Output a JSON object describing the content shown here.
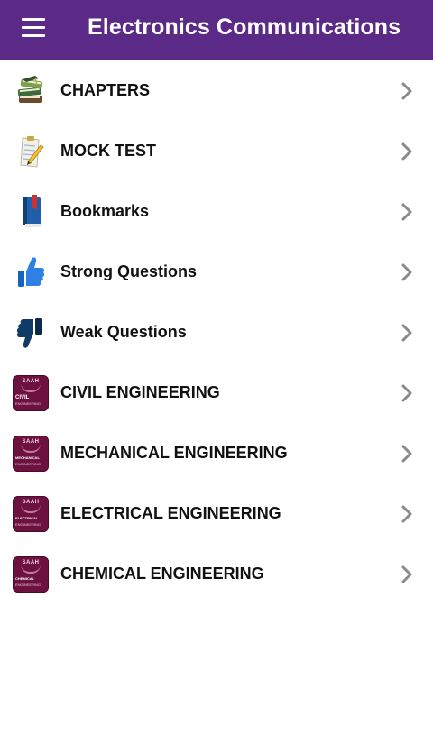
{
  "header": {
    "title": "Electronics Communications",
    "menu_icon": "hamburger-icon"
  },
  "items": [
    {
      "label": "CHAPTERS",
      "icon": "books-icon"
    },
    {
      "label": "MOCK TEST",
      "icon": "notepad-pencil-icon"
    },
    {
      "label": "Bookmarks",
      "icon": "bookmark-book-icon"
    },
    {
      "label": "Strong Questions",
      "icon": "thumbs-up-icon"
    },
    {
      "label": "Weak Questions",
      "icon": "thumbs-down-icon"
    },
    {
      "label": "CIVIL ENGINEERING",
      "icon": "civil-engineering-logo-icon",
      "badge_top": "SAAH",
      "badge_name": "CIVIL",
      "badge_sub": "ENGINEERING"
    },
    {
      "label": "MECHANICAL ENGINEERING",
      "icon": "mechanical-engineering-logo-icon",
      "badge_top": "SAAH",
      "badge_name": "MECHANICAL",
      "badge_sub": "ENGINEERING"
    },
    {
      "label": "ELECTRICAL ENGINEERING",
      "icon": "electrical-engineering-logo-icon",
      "badge_top": "SAAH",
      "badge_name": "ELECTRICAL",
      "badge_sub": "ENGINEERING"
    },
    {
      "label": "CHEMICAL ENGINEERING",
      "icon": "chemical-engineering-logo-icon",
      "badge_top": "SAAH",
      "badge_name": "CHEMICAL",
      "badge_sub": "ENGINEERING"
    }
  ],
  "colors": {
    "appbar": "#5b2a86",
    "chevron": "#8a8a8a",
    "badge": "#6d1240"
  }
}
